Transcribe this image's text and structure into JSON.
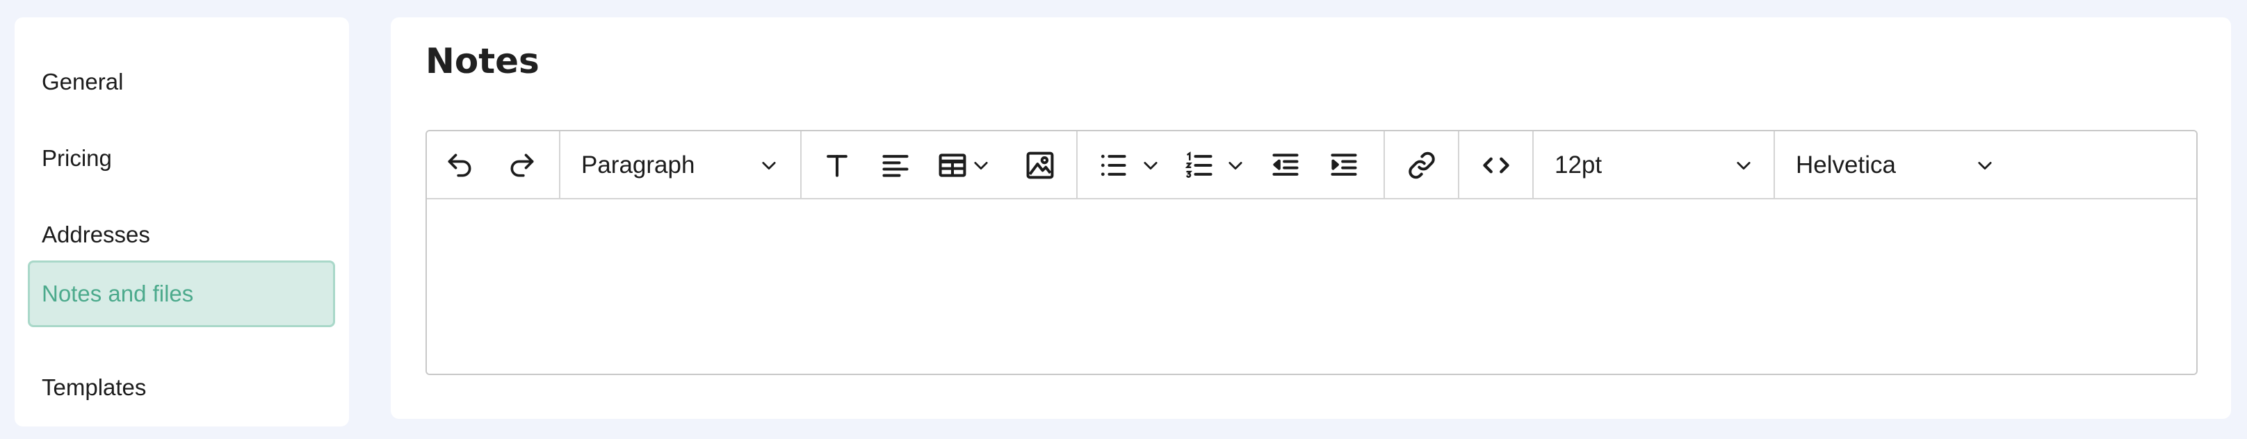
{
  "sidebar": {
    "items": [
      {
        "label": "General"
      },
      {
        "label": "Pricing"
      },
      {
        "label": "Addresses"
      },
      {
        "label": "Notes and files",
        "active": true
      },
      {
        "label": "Templates"
      }
    ]
  },
  "main": {
    "title": "Notes"
  },
  "editor": {
    "block_format": "Paragraph",
    "font_size": "12pt",
    "font_family": "Helvetica",
    "content": ""
  },
  "colors": {
    "page_bg": "#f1f4fc",
    "active_bg": "#d7ece6",
    "active_border": "#a9d8c9",
    "active_text": "#4caa8c"
  },
  "icons": [
    "undo-icon",
    "redo-icon",
    "chevron-down-icon",
    "text-format-icon",
    "align-left-icon",
    "table-icon",
    "image-icon",
    "bullet-list-icon",
    "numbered-list-icon",
    "outdent-icon",
    "indent-icon",
    "link-icon",
    "code-icon"
  ]
}
